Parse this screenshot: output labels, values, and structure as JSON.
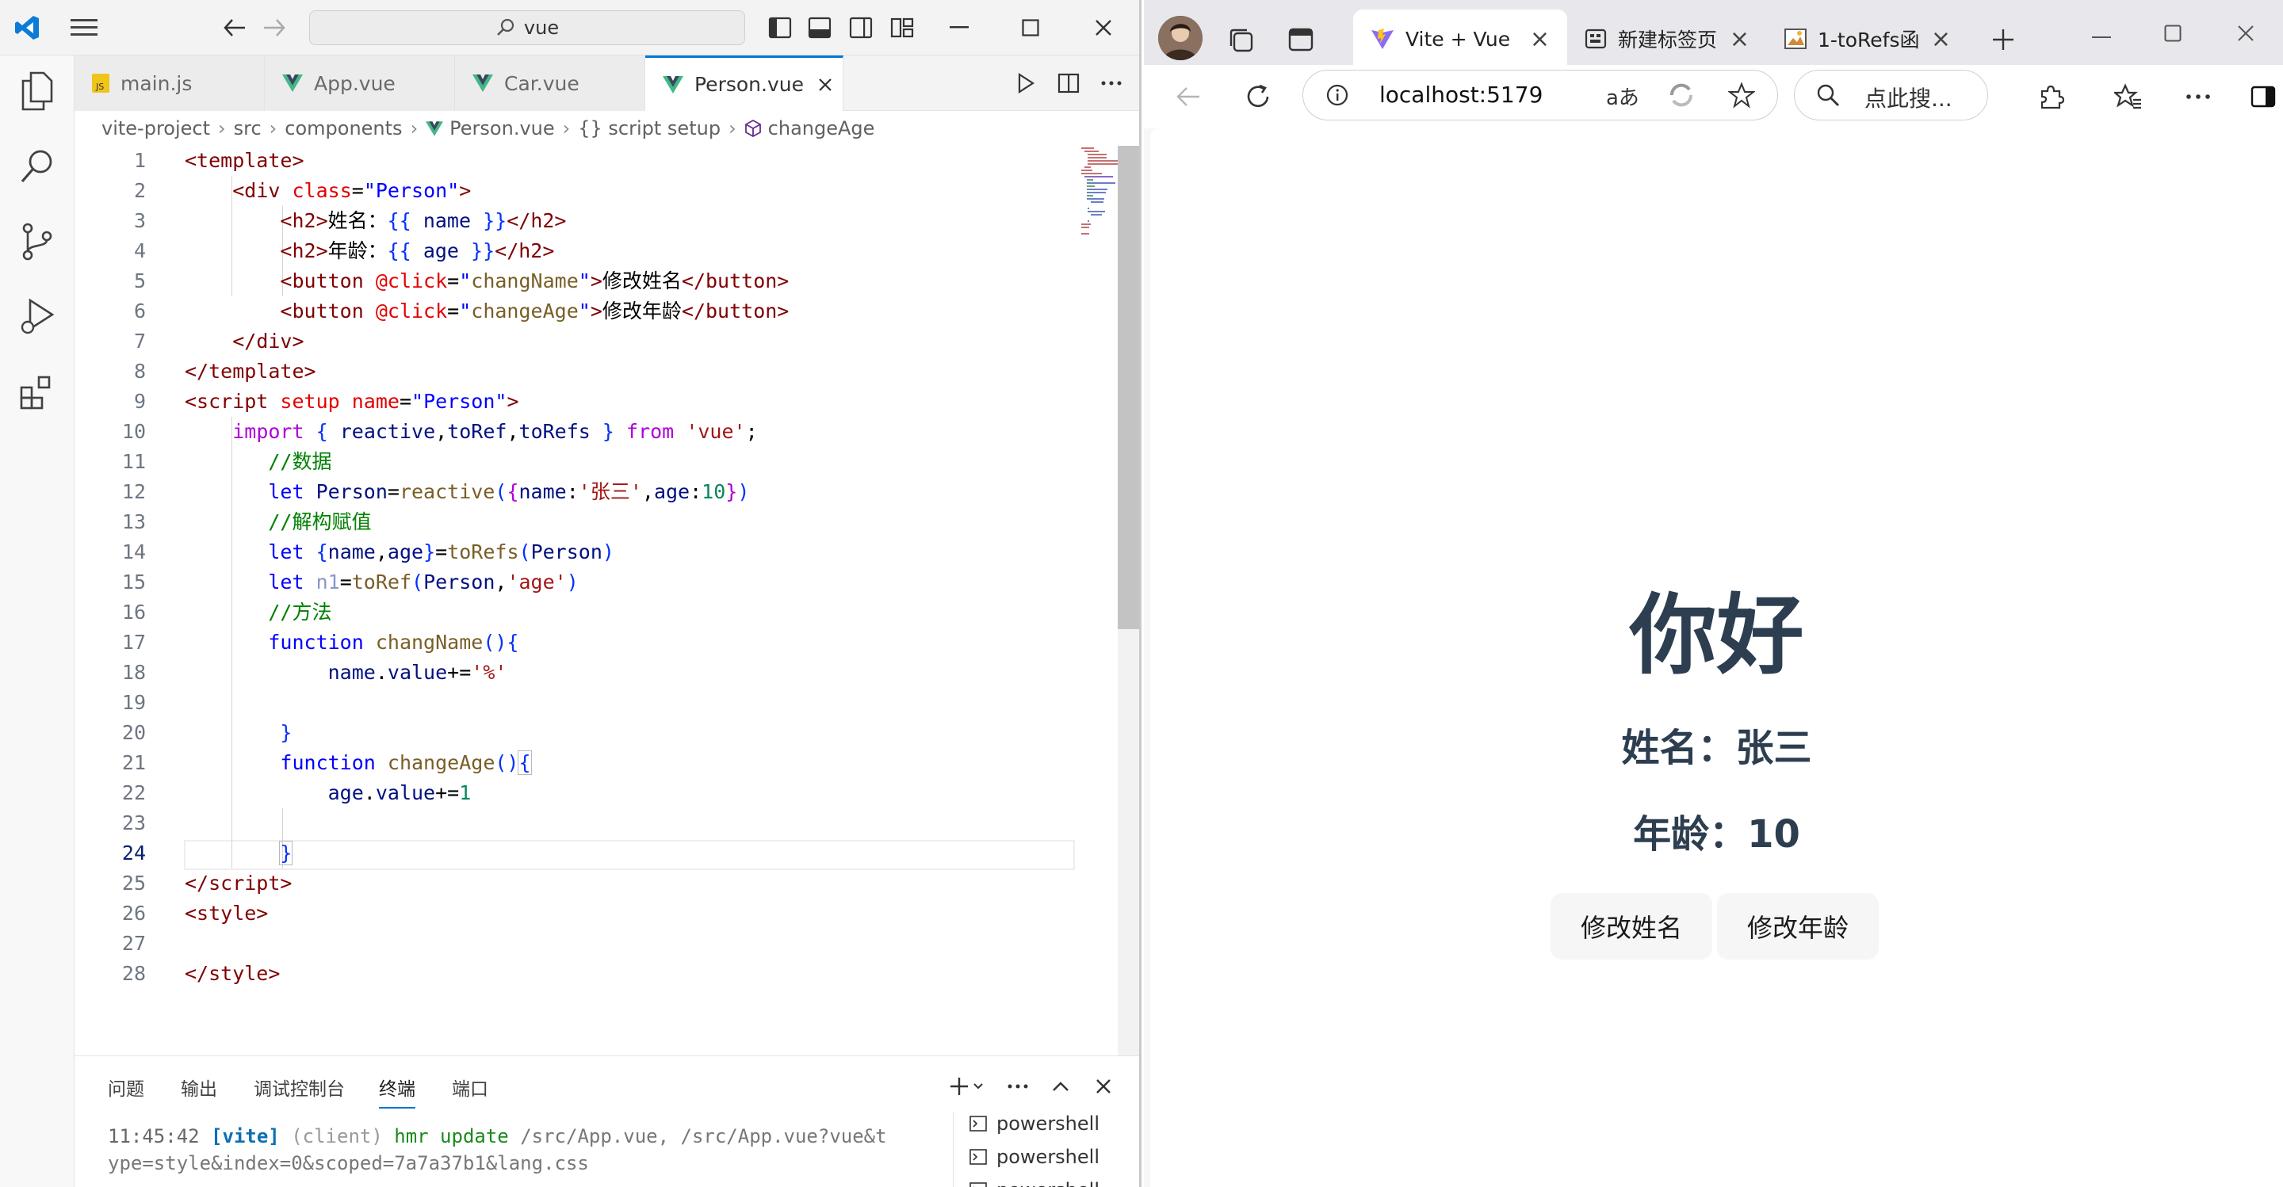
{
  "vscode": {
    "command_center": "vue",
    "tabs": [
      {
        "label": "main.js",
        "icon": "js-file-icon"
      },
      {
        "label": "App.vue",
        "icon": "vue-file-icon"
      },
      {
        "label": "Car.vue",
        "icon": "vue-file-icon"
      },
      {
        "label": "Person.vue",
        "icon": "vue-file-icon",
        "active": true
      }
    ],
    "breadcrumb": [
      "vite-project",
      "src",
      "components",
      "Person.vue",
      "{} script setup",
      "changeAge"
    ],
    "current_line": 24,
    "panel": {
      "tabs": [
        "问题",
        "输出",
        "调试控制台",
        "终端",
        "端口"
      ],
      "active_tab": "终端",
      "terminal": {
        "time": "11:45:42",
        "tag": "[vite]",
        "client": "(client)",
        "msg": "hmr update",
        "path1": "/src/App.vue, /src/App.vue?vue&t",
        "path2": "ype=style&index=0&scoped=7a7a37b1&lang.css"
      },
      "terminal_list": [
        "powershell",
        "powershell",
        "powershell"
      ]
    },
    "colors": {
      "accent": "#0078d4",
      "vue_green": "#41b883"
    }
  },
  "browser": {
    "tabs": [
      {
        "label": "Vite + Vue",
        "active": true
      },
      {
        "label": "新建标签页"
      },
      {
        "label": "1-toRefs函"
      }
    ],
    "address": "localhost:5179",
    "search_placeholder": "点此搜...",
    "page": {
      "heading": "你好",
      "name_line": "姓名：张三",
      "age_line": "年龄：10",
      "btn_name": "修改姓名",
      "btn_age": "修改年龄"
    }
  }
}
